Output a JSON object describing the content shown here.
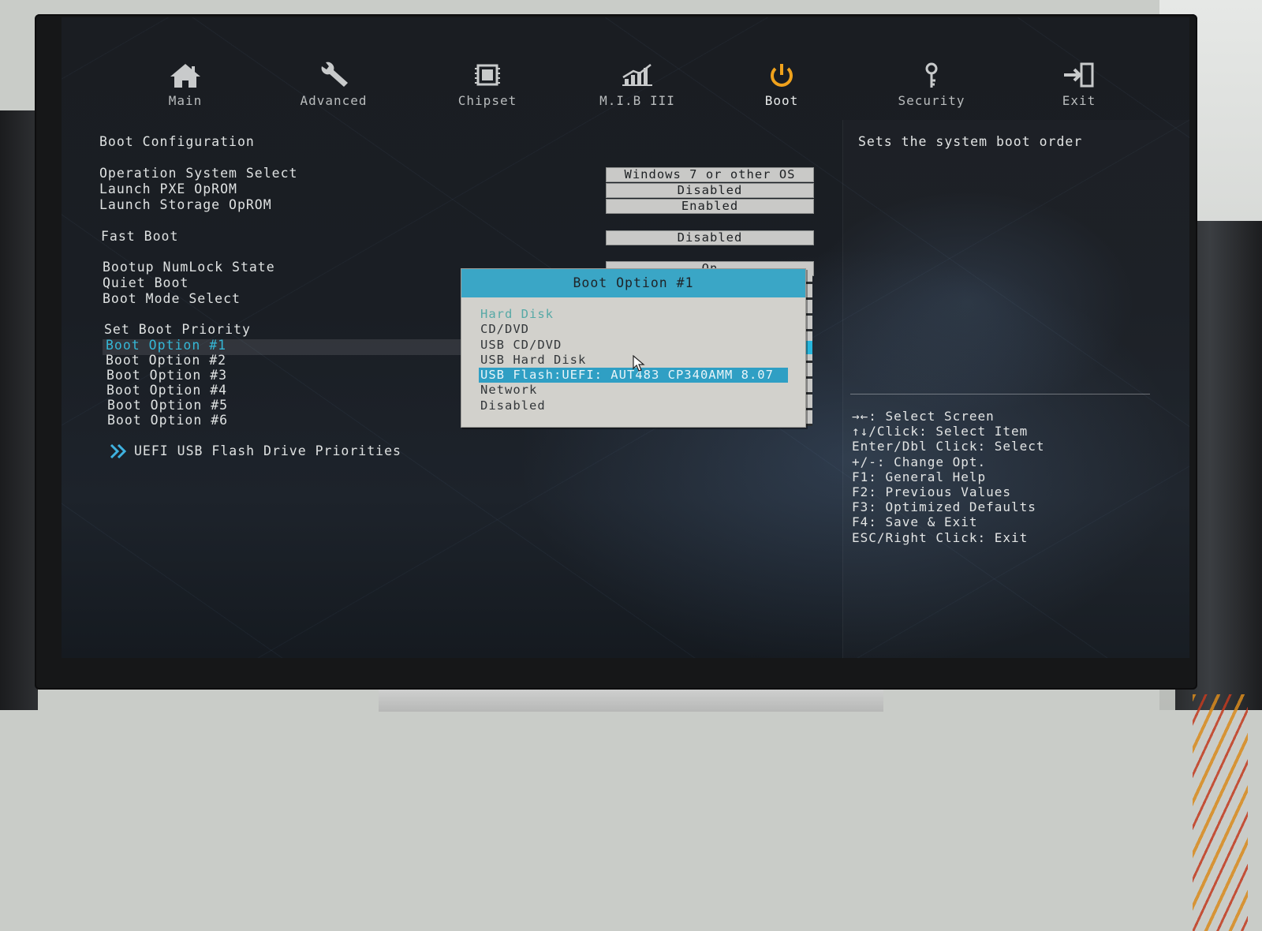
{
  "tabs": [
    {
      "label": "Main",
      "icon": "home-icon"
    },
    {
      "label": "Advanced",
      "icon": "wrench-icon"
    },
    {
      "label": "Chipset",
      "icon": "chip-icon"
    },
    {
      "label": "M.I.B III",
      "icon": "chart-icon"
    },
    {
      "label": "Boot",
      "icon": "power-icon",
      "active": true
    },
    {
      "label": "Security",
      "icon": "key-icon"
    },
    {
      "label": "Exit",
      "icon": "exit-icon"
    }
  ],
  "boot": {
    "section_title": "Boot Configuration",
    "settings": [
      {
        "label": "Operation System Select",
        "value": "Windows 7 or other OS"
      },
      {
        "label": "Launch PXE OpROM",
        "value": "Disabled"
      },
      {
        "label": "Launch Storage OpROM",
        "value": "Enabled"
      },
      {
        "label": "Fast Boot",
        "value": "Disabled"
      },
      {
        "label": "Bootup NumLock State",
        "value": "On"
      },
      {
        "label": "Quiet Boot",
        "value": ""
      },
      {
        "label": "Boot Mode Select",
        "value": ""
      }
    ],
    "priority_title": "Set Boot Priority",
    "boot_options": [
      "Boot Option #1",
      "Boot Option #2",
      "Boot Option #3",
      "Boot Option #4",
      "Boot Option #5",
      "Boot Option #6"
    ],
    "uefi_link": "UEFI USB Flash Drive Priorities"
  },
  "popup": {
    "title": "Boot Option #1",
    "options": [
      "Hard Disk",
      "CD/DVD",
      "USB CD/DVD",
      "USB Hard Disk",
      "USB Flash:UEFI: AUT483 CP340AMM 8.07",
      "Network",
      "Disabled"
    ],
    "selected_index": 4
  },
  "help": {
    "description": "Sets the system boot order",
    "keys": [
      "→←: Select Screen",
      "↑↓/Click: Select Item",
      "Enter/Dbl Click: Select",
      "+/-: Change Opt.",
      "F1: General Help",
      "F2: Previous Values",
      "F3: Optimized Defaults",
      "F4: Save & Exit",
      "ESC/Right Click: Exit"
    ]
  },
  "colors": {
    "accent": "#3aa6c6",
    "selected_text": "#35b7d6",
    "boot_icon": "#f0a21c"
  }
}
